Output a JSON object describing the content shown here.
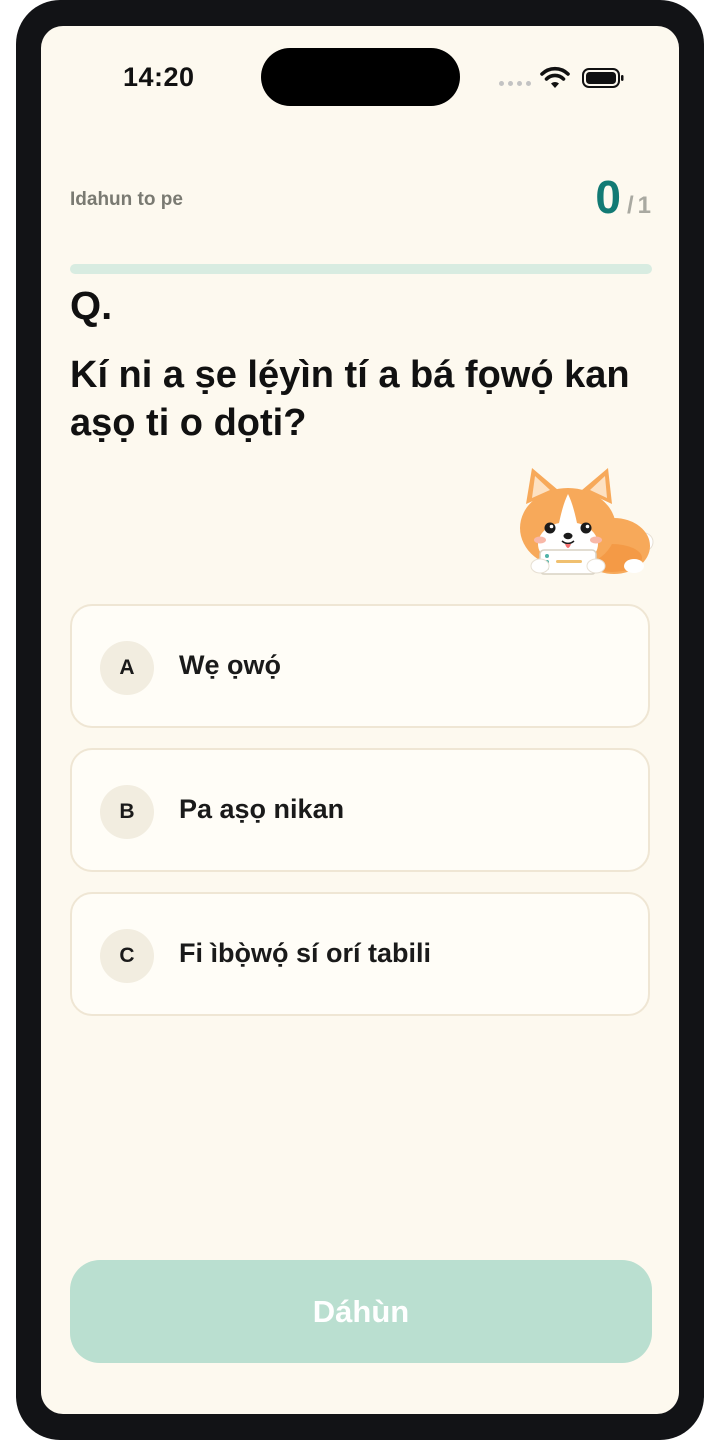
{
  "status_bar": {
    "time": "14:20"
  },
  "quiz": {
    "progress_label": "Idahun to pe",
    "score_current": "0",
    "score_separator": "/",
    "score_total": "1",
    "progress_fraction": 0,
    "question_marker": "Q.",
    "question_text": "Kí ni a ṣe lẹ́yìn tí a bá fọwọ́ kan aṣọ ti o dọti?",
    "options": [
      {
        "letter": "A",
        "text": "Wẹ ọwọ́"
      },
      {
        "letter": "B",
        "text": "Pa aṣọ nikan"
      },
      {
        "letter": "C",
        "text": "Fi ìbọ̀wọ́ sí orí tabili"
      }
    ],
    "submit_label": "Dáhùn"
  },
  "colors": {
    "accent": "#127a74",
    "background": "#fdf9ef",
    "button_disabled": "#badfd0",
    "progress_track": "#d8ece1"
  },
  "icons": {
    "wifi": "wifi-icon",
    "battery": "battery-icon",
    "signal": "cellular-signal-icon",
    "mascot": "corgi-mascot"
  }
}
